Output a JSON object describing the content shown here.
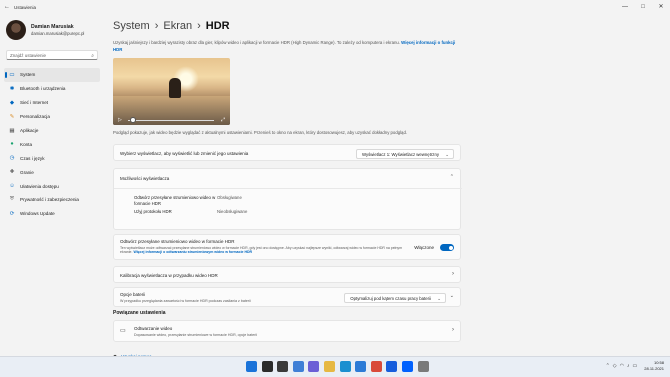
{
  "window": {
    "title": "Ustawienia",
    "back_icon": "back-arrow-icon",
    "minimize": "—",
    "maximize": "□",
    "close": "✕"
  },
  "profile": {
    "name": "Damian Marusiak",
    "email": "damian.marusiak@purepc.pl"
  },
  "search": {
    "placeholder": "Znajdź ustawienie"
  },
  "nav": [
    {
      "label": "System",
      "icon": "monitor-icon",
      "glyph": "▭",
      "color": "#0067c0",
      "active": true
    },
    {
      "label": "Bluetooth i urządzenia",
      "icon": "bluetooth-icon",
      "glyph": "✱",
      "color": "#0067c0"
    },
    {
      "label": "Sieć i Internet",
      "icon": "wifi-icon",
      "glyph": "◆",
      "color": "#0067c0"
    },
    {
      "label": "Personalizacja",
      "icon": "brush-icon",
      "glyph": "✎",
      "color": "#d98e2a"
    },
    {
      "label": "Aplikacje",
      "icon": "apps-icon",
      "glyph": "▦",
      "color": "#555"
    },
    {
      "label": "Konta",
      "icon": "account-icon",
      "glyph": "●",
      "color": "#1aa36f"
    },
    {
      "label": "Czas i język",
      "icon": "clock-globe-icon",
      "glyph": "◷",
      "color": "#0067c0"
    },
    {
      "label": "Granie",
      "icon": "gamepad-icon",
      "glyph": "✚",
      "color": "#555"
    },
    {
      "label": "Ułatwienia dostępu",
      "icon": "accessibility-icon",
      "glyph": "☺",
      "color": "#0067c0"
    },
    {
      "label": "Prywatność i zabezpieczenia",
      "icon": "shield-icon",
      "glyph": "⛨",
      "color": "#666"
    },
    {
      "label": "Windows Update",
      "icon": "update-icon",
      "glyph": "⟳",
      "color": "#0067c0"
    }
  ],
  "breadcrumb": {
    "a": "System",
    "b": "Ekran",
    "current": "HDR",
    "sep": "›"
  },
  "description": {
    "text": "Uzyskaj jaśniejszy i bardziej wyrazisty obraz dla gier, klipów wideo i aplikacji w formacie HDR (High Dynamic Range). To zależy od komputera i ekranu.",
    "link": "Więcej informacji o funkcji HDR"
  },
  "video": {
    "play_icon": "play-icon",
    "fullscreen_icon": "fullscreen-icon",
    "progress": 0.02
  },
  "preview_hint": "Podgląd pokazuje, jak wideo będzie wyglądać z aktualnymi ustawieniami. Przenieś to okno na ekran, który dostosowujesz, aby uzyskać dokładny podgląd.",
  "display_select": {
    "label": "Wybierz wyświetlacz, aby wyświetlić lub zmienić jego ustawienia",
    "value": "Wyświetlacz 1: Wyświetlacz wewnętrzny"
  },
  "capabilities": {
    "title": "Możliwości wyświetlacza",
    "rows": [
      {
        "label": "Odtwórz przesyłane strumieniowo wideo w formacie HDR",
        "value": "Obsługiwane"
      },
      {
        "label": "Użyj protokołu HDR",
        "value": "Nieobsługiwane"
      }
    ]
  },
  "hdr_stream": {
    "title": "Odtwórz przesyłane strumieniowo wideo w formacie HDR",
    "desc": "Ten wyświetlacz może odtwarzać przesyłane strumieniowo wideo w formacie HDR, gdy jest ono dostępne. Aby uzyskać najlepsze wyniki, odtwarzaj wideo w formacie HDR na pełnym ekranie.",
    "link": "Więcej informacji o odtwarzaniu strumieniowym wideo w formacie HDR",
    "state": "Włączone"
  },
  "calibration": {
    "label": "Kalibracja wyświetlacza w przypadku wideo HDR"
  },
  "battery": {
    "title": "Opcje baterii",
    "desc": "W przypadku przeglądania zawartości w formacie HDR podczas zasilania z baterii",
    "value": "Optymalizuj pod kątem czasu pracy baterii"
  },
  "related": {
    "title": "Powiązane ustawienia",
    "item_title": "Odtwarzanie wideo",
    "item_desc": "Dopasowanie wideo, przesyłanie strumieniowe w formacie HDR, opcje baterii"
  },
  "help": {
    "label": "Uzyskaj pomoc"
  },
  "taskbar": {
    "icons": [
      {
        "name": "start-icon",
        "color": "#1a73d9"
      },
      {
        "name": "search-icon",
        "color": "#2b2b2b"
      },
      {
        "name": "task-view-icon",
        "color": "#3a3a3a"
      },
      {
        "name": "widgets-icon",
        "color": "#3f7fd6"
      },
      {
        "name": "chat-icon",
        "color": "#6b5fd6"
      },
      {
        "name": "file-explorer-icon",
        "color": "#e6b843"
      },
      {
        "name": "edge-icon",
        "color": "#1a8fd0"
      },
      {
        "name": "store-icon",
        "color": "#2c7bd6"
      },
      {
        "name": "chrome-icon",
        "color": "#d94a3a"
      },
      {
        "name": "bitwarden-icon",
        "color": "#175ddc"
      },
      {
        "name": "dropbox-icon",
        "color": "#0061fe"
      },
      {
        "name": "settings-icon",
        "color": "#7a7a7a"
      }
    ],
    "time": "10:58",
    "date": "28.11.2021"
  }
}
